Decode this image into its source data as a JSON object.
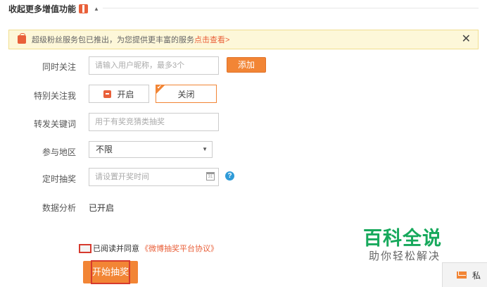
{
  "collapse": {
    "title": "收起更多增值功能",
    "arrow": "▲"
  },
  "notice": {
    "text": "超级粉丝服务包已推出，为您提供更丰富的服务",
    "link": "点击查看>",
    "close": "✕"
  },
  "form": {
    "follow": {
      "label": "同时关注",
      "placeholder": "请输入用户昵称，最多3个",
      "add_label": "添加"
    },
    "special_follow": {
      "label": "特别关注我",
      "on_label": "开启",
      "off_label": "关闭",
      "selected": "关闭"
    },
    "keyword": {
      "label": "转发关键词",
      "placeholder": "用于有奖竞猜类抽奖"
    },
    "region": {
      "label": "参与地区",
      "value": "不限",
      "caret": "▼"
    },
    "schedule": {
      "label": "定时抽奖",
      "placeholder": "请设置开奖时间",
      "calendar_text": "31",
      "help": "?"
    },
    "analysis": {
      "label": "数据分析",
      "value": "已开启"
    }
  },
  "agreement": {
    "text": "已阅读并同意",
    "link": "《微博抽奖平台协议》",
    "checked": false
  },
  "start_button": {
    "label": "开始抽奖"
  },
  "watermark": {
    "title": "百科全说",
    "subtitle": "助你轻松解决"
  },
  "dm_tab": {
    "label": "私"
  },
  "colors": {
    "accent": "#f28535",
    "link": "#e9603a",
    "highlight": "#d63a2e",
    "watermark": "#17a95c"
  }
}
